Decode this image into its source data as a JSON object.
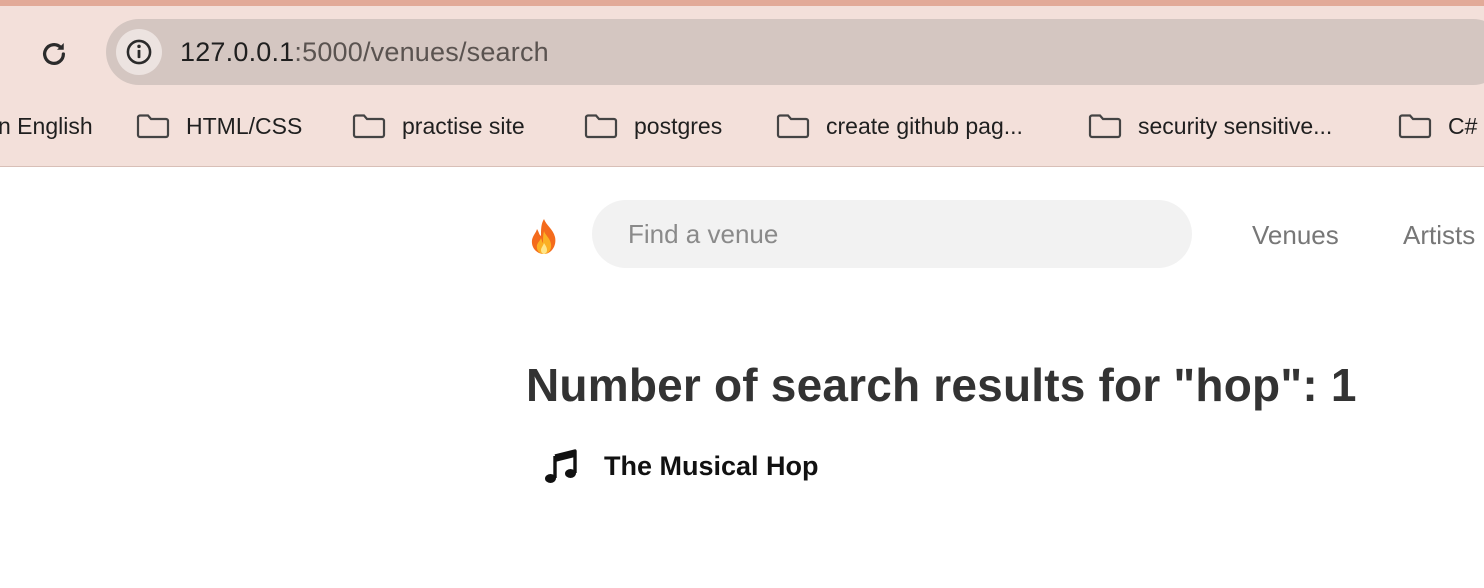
{
  "browser": {
    "url_host": "127.0.0.1",
    "url_path": ":5000/venues/search",
    "bookmarks": [
      {
        "label": "n English"
      },
      {
        "label": "HTML/CSS"
      },
      {
        "label": "practise site"
      },
      {
        "label": "postgres"
      },
      {
        "label": "create github pag..."
      },
      {
        "label": "security sensitive..."
      },
      {
        "label": "C#"
      }
    ],
    "icons": {
      "reload": "reload-icon",
      "site_info": "info-icon",
      "bookmark": "folder-icon"
    }
  },
  "navbar": {
    "brand_icon": "fire-icon",
    "search_placeholder": "Find a venue",
    "links": [
      {
        "label": "Venues"
      },
      {
        "label": "Artists"
      }
    ]
  },
  "main": {
    "heading": "Number of search results for \"hop\": 1",
    "results": [
      {
        "icon": "music-note-icon",
        "name": "The Musical Hop"
      }
    ]
  },
  "colors": {
    "chrome_background": "#f3e0da",
    "address_bar": "#d4c6c1",
    "search_background": "#f2f2f2",
    "nav_link": "#777777",
    "heading": "#333333"
  }
}
